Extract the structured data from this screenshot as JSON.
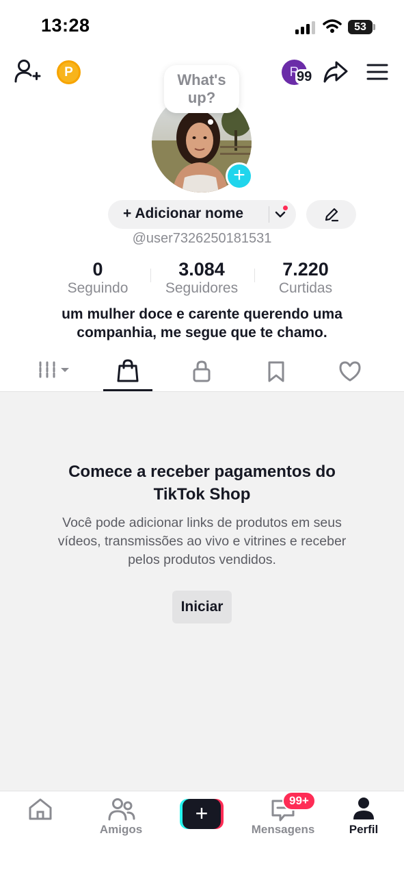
{
  "status_bar": {
    "time": "13:28",
    "battery": "53"
  },
  "header": {
    "coin_letter": "P",
    "avatar_letter": "R",
    "notification_count": "99"
  },
  "bubble": {
    "text_line1": "What's",
    "text_line2": "up?"
  },
  "profile": {
    "name_button": "+ Adicionar nome",
    "username": "@user7326250181531",
    "stats": [
      {
        "value": "0",
        "label": "Seguindo"
      },
      {
        "value": "3.084",
        "label": "Seguidores"
      },
      {
        "value": "7.220",
        "label": "Curtidas"
      }
    ],
    "bio_line1": "um mulher doce e carente querendo uma",
    "bio_line2": "companhia, me segue que te chamo."
  },
  "tabs": [
    "videos-grid-icon",
    "shop-bag-icon",
    "lock-icon",
    "bookmark-icon",
    "heart-icon"
  ],
  "empty_state": {
    "title_line1": "Comece a receber pagamentos do",
    "title_line2": "TikTok Shop",
    "desc_line1": "Você pode adicionar links de produtos em seus",
    "desc_line2": "vídeos, transmissões ao vivo e vitrines e receber",
    "desc_line3": "pelos produtos vendidos.",
    "button": "Iniciar"
  },
  "bottom_nav": {
    "friends": "Amigos",
    "messages": "Mensagens",
    "messages_badge": "99+",
    "profile": "Perfil"
  },
  "colors": {
    "accent": "#fe2c55",
    "cyan": "#25f4ee",
    "text": "#161823",
    "muted": "#8a8b91"
  }
}
